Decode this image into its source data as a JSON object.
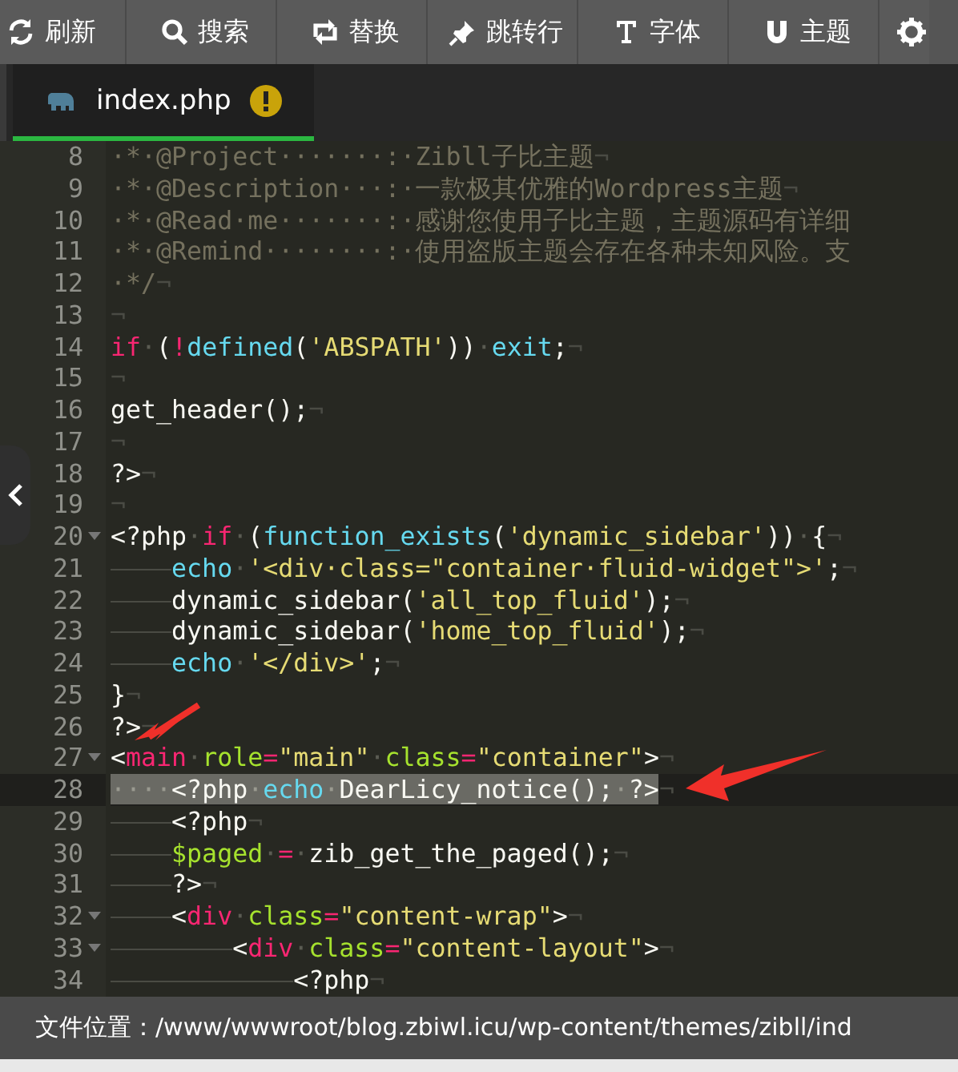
{
  "toolbar": [
    "刷新",
    "搜索",
    "替换",
    "跳转行",
    "字体",
    "主题"
  ],
  "tabs": [
    {
      "label": "index.php",
      "selected": true,
      "warning": true
    }
  ],
  "lines": [
    {
      "number": "8",
      "segments": [
        {
          "kind": "comment",
          "text": "·*·@Project·······:·Zibll子比主题"
        },
        {
          "kind": "eol",
          "text": "¬"
        }
      ]
    },
    {
      "number": "9",
      "segments": [
        {
          "kind": "comment",
          "text": "·*·@Description···:·一款极其优雅的Wordpress主题"
        },
        {
          "kind": "eol",
          "text": "¬"
        }
      ]
    },
    {
      "number": "10",
      "segments": [
        {
          "kind": "comment",
          "text": "·*·@Read·me·······:·感谢您使用子比主题，主题源码有详细"
        }
      ]
    },
    {
      "number": "11",
      "segments": [
        {
          "kind": "comment",
          "text": "·*·@Remind········:·使用盗版主题会存在各种未知风险。支"
        }
      ]
    },
    {
      "number": "12",
      "segments": [
        {
          "kind": "comment",
          "text": "·*/"
        },
        {
          "kind": "eol",
          "text": "¬"
        }
      ]
    },
    {
      "number": "13",
      "segments": [
        {
          "kind": "eol",
          "text": "¬"
        }
      ]
    },
    {
      "number": "14",
      "segments": [
        {
          "kind": "kw",
          "text": "if"
        },
        {
          "kind": "ws",
          "text": "·"
        },
        {
          "kind": "plain",
          "text": "("
        },
        {
          "kind": "kw",
          "text": "!"
        },
        {
          "kind": "fn",
          "text": "defined"
        },
        {
          "kind": "plain",
          "text": "("
        },
        {
          "kind": "str",
          "text": "'ABSPATH'"
        },
        {
          "kind": "plain",
          "text": "))"
        },
        {
          "kind": "ws",
          "text": "·"
        },
        {
          "kind": "fn",
          "text": "exit"
        },
        {
          "kind": "plain",
          "text": ";"
        },
        {
          "kind": "eol",
          "text": "¬"
        }
      ]
    },
    {
      "number": "15",
      "segments": [
        {
          "kind": "eol",
          "text": "¬"
        }
      ]
    },
    {
      "number": "16",
      "segments": [
        {
          "kind": "plain",
          "text": "get_header();"
        },
        {
          "kind": "eol",
          "text": "¬"
        }
      ]
    },
    {
      "number": "17",
      "segments": [
        {
          "kind": "eol",
          "text": "¬"
        }
      ]
    },
    {
      "number": "18",
      "segments": [
        {
          "kind": "plain",
          "text": "?>"
        },
        {
          "kind": "eol",
          "text": "¬"
        }
      ]
    },
    {
      "number": "19",
      "segments": [
        {
          "kind": "eol",
          "text": "¬"
        }
      ]
    },
    {
      "number": "20",
      "foldable": true,
      "segments": [
        {
          "kind": "plain",
          "text": "<?php"
        },
        {
          "kind": "ws",
          "text": "·"
        },
        {
          "kind": "kw",
          "text": "if"
        },
        {
          "kind": "ws",
          "text": "·"
        },
        {
          "kind": "plain",
          "text": "("
        },
        {
          "kind": "fn",
          "text": "function_exists"
        },
        {
          "kind": "plain",
          "text": "("
        },
        {
          "kind": "str",
          "text": "'dynamic_sidebar'"
        },
        {
          "kind": "plain",
          "text": "))"
        },
        {
          "kind": "ws",
          "text": "·"
        },
        {
          "kind": "plain",
          "text": "{"
        },
        {
          "kind": "eol",
          "text": "¬"
        }
      ]
    },
    {
      "number": "21",
      "segments": [
        {
          "kind": "tab"
        },
        {
          "kind": "fn",
          "text": "echo"
        },
        {
          "kind": "ws",
          "text": "·"
        },
        {
          "kind": "str",
          "text": "'<div·class=\"container·fluid-widget\">'"
        },
        {
          "kind": "plain",
          "text": ";"
        },
        {
          "kind": "eol",
          "text": "¬"
        }
      ]
    },
    {
      "number": "22",
      "segments": [
        {
          "kind": "tab"
        },
        {
          "kind": "plain",
          "text": "dynamic_sidebar("
        },
        {
          "kind": "str",
          "text": "'all_top_fluid'"
        },
        {
          "kind": "plain",
          "text": ");"
        },
        {
          "kind": "eol",
          "text": "¬"
        }
      ]
    },
    {
      "number": "23",
      "segments": [
        {
          "kind": "tab"
        },
        {
          "kind": "plain",
          "text": "dynamic_sidebar("
        },
        {
          "kind": "str",
          "text": "'home_top_fluid'"
        },
        {
          "kind": "plain",
          "text": ");"
        },
        {
          "kind": "eol",
          "text": "¬"
        }
      ]
    },
    {
      "number": "24",
      "segments": [
        {
          "kind": "tab"
        },
        {
          "kind": "fn",
          "text": "echo"
        },
        {
          "kind": "ws",
          "text": "·"
        },
        {
          "kind": "str",
          "text": "'</div>'"
        },
        {
          "kind": "plain",
          "text": ";"
        },
        {
          "kind": "eol",
          "text": "¬"
        }
      ]
    },
    {
      "number": "25",
      "segments": [
        {
          "kind": "plain",
          "text": "}"
        },
        {
          "kind": "eol",
          "text": "¬"
        }
      ]
    },
    {
      "number": "26",
      "segments": [
        {
          "kind": "plain",
          "text": "?>"
        },
        {
          "kind": "eol",
          "text": "¬"
        }
      ]
    },
    {
      "number": "27",
      "foldable": true,
      "segments": [
        {
          "kind": "plain",
          "text": "<"
        },
        {
          "kind": "kw",
          "text": "main"
        },
        {
          "kind": "ws",
          "text": "·"
        },
        {
          "kind": "attr",
          "text": "role"
        },
        {
          "kind": "kw",
          "text": "="
        },
        {
          "kind": "str",
          "text": "\"main\""
        },
        {
          "kind": "ws",
          "text": "·"
        },
        {
          "kind": "attr",
          "text": "class"
        },
        {
          "kind": "kw",
          "text": "="
        },
        {
          "kind": "str",
          "text": "\"container\""
        },
        {
          "kind": "plain",
          "text": ">"
        },
        {
          "kind": "eol",
          "text": "¬"
        }
      ]
    },
    {
      "number": "28",
      "current": true,
      "selected": true,
      "segments": [
        {
          "kind": "ws",
          "text": "····"
        },
        {
          "kind": "plain",
          "text": "<?php"
        },
        {
          "kind": "ws",
          "text": "·"
        },
        {
          "kind": "fn",
          "text": "echo"
        },
        {
          "kind": "ws",
          "text": "·"
        },
        {
          "kind": "plain",
          "text": "DearLicy_notice();"
        },
        {
          "kind": "ws",
          "text": "·"
        },
        {
          "kind": "plain",
          "text": "?>"
        },
        {
          "kind": "eol",
          "text": "¬"
        }
      ]
    },
    {
      "number": "29",
      "segments": [
        {
          "kind": "tab"
        },
        {
          "kind": "plain",
          "text": "<?php"
        },
        {
          "kind": "eol",
          "text": "¬"
        }
      ]
    },
    {
      "number": "30",
      "segments": [
        {
          "kind": "tab"
        },
        {
          "kind": "attr",
          "text": "$paged"
        },
        {
          "kind": "ws",
          "text": "·"
        },
        {
          "kind": "kw",
          "text": "="
        },
        {
          "kind": "ws",
          "text": "·"
        },
        {
          "kind": "plain",
          "text": "zib_get_the_paged();"
        },
        {
          "kind": "eol",
          "text": "¬"
        }
      ]
    },
    {
      "number": "31",
      "segments": [
        {
          "kind": "tab"
        },
        {
          "kind": "plain",
          "text": "?>"
        },
        {
          "kind": "eol",
          "text": "¬"
        }
      ]
    },
    {
      "number": "32",
      "foldable": true,
      "segments": [
        {
          "kind": "tab"
        },
        {
          "kind": "plain",
          "text": "<"
        },
        {
          "kind": "kw",
          "text": "div"
        },
        {
          "kind": "ws",
          "text": "·"
        },
        {
          "kind": "attr",
          "text": "class"
        },
        {
          "kind": "kw",
          "text": "="
        },
        {
          "kind": "str",
          "text": "\"content-wrap\""
        },
        {
          "kind": "plain",
          "text": ">"
        },
        {
          "kind": "eol",
          "text": "¬"
        }
      ]
    },
    {
      "number": "33",
      "foldable": true,
      "segments": [
        {
          "kind": "tab"
        },
        {
          "kind": "tab"
        },
        {
          "kind": "plain",
          "text": "<"
        },
        {
          "kind": "kw",
          "text": "div"
        },
        {
          "kind": "ws",
          "text": "·"
        },
        {
          "kind": "attr",
          "text": "class"
        },
        {
          "kind": "kw",
          "text": "="
        },
        {
          "kind": "str",
          "text": "\"content-layout\""
        },
        {
          "kind": "plain",
          "text": ">"
        },
        {
          "kind": "eol",
          "text": "¬"
        }
      ]
    },
    {
      "number": "34",
      "segments": [
        {
          "kind": "tab"
        },
        {
          "kind": "tab"
        },
        {
          "kind": "tab"
        },
        {
          "kind": "plain",
          "text": "<?php"
        },
        {
          "kind": "eol",
          "text": "¬"
        }
      ]
    }
  ],
  "status_bar": {
    "text": "文件位置：/www/wwwroot/blog.zbiwl.icu/wp-content/themes/zibll/ind"
  }
}
